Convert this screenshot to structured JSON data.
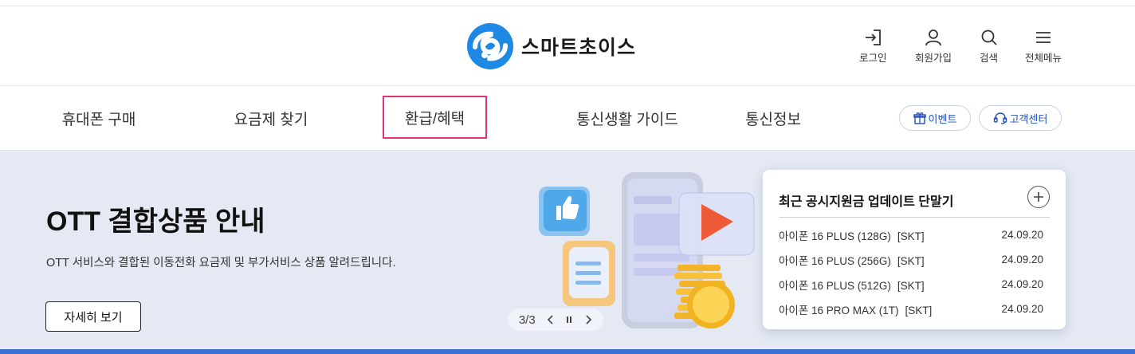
{
  "brand": {
    "name": "스마트초이스",
    "logo_colors": {
      "primary": "#1e88e5",
      "dark": "#1565c0"
    }
  },
  "utility_menu": [
    {
      "icon": "login-icon",
      "label": "로그인"
    },
    {
      "icon": "user-icon",
      "label": "회원가입"
    },
    {
      "icon": "search-icon",
      "label": "검색"
    },
    {
      "icon": "hamburger-menu-icon",
      "label": "전체메뉴"
    }
  ],
  "nav": {
    "items": [
      {
        "label": "휴대폰 구매"
      },
      {
        "label": "요금제 찾기"
      },
      {
        "label": "환급/혜택",
        "active": true
      },
      {
        "label": "통신생활 가이드"
      },
      {
        "label": "통신정보"
      }
    ],
    "event_label": "이벤트",
    "support_label": "고객센터",
    "active_outline_color": "#e0337e",
    "pill_text_color": "#2251b8"
  },
  "hero": {
    "title": "OTT 결합상품 안내",
    "description": "OTT 서비스와 결합된 이동전화 요금제 및 부가서비스 상품 알려드립니다.",
    "button_label": "자세히 보기",
    "slide_counter": "3/3",
    "background_color": "#e4e9f3"
  },
  "update_card": {
    "title": "최근 공시지원금 업데이트 단말기",
    "rows": [
      {
        "name": "아이폰 16 PLUS (128G)",
        "carrier": "[SKT]",
        "date": "24.09.20"
      },
      {
        "name": "아이폰 16 PLUS (256G)",
        "carrier": "[SKT]",
        "date": "24.09.20"
      },
      {
        "name": "아이폰 16 PLUS (512G)",
        "carrier": "[SKT]",
        "date": "24.09.20"
      },
      {
        "name": "아이폰 16 PRO MAX (1T)",
        "carrier": "[SKT]",
        "date": "24.09.20"
      }
    ]
  },
  "accent_bar_color": "#3b6fd1"
}
